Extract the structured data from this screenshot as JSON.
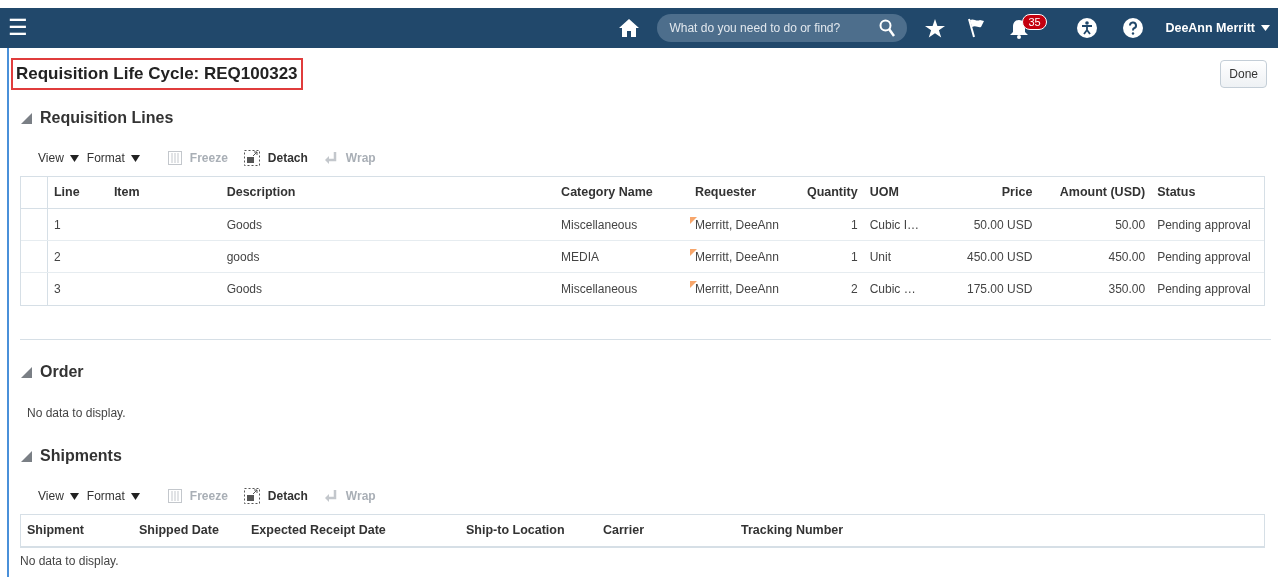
{
  "top_bar": {
    "menu_icon": "☰",
    "search": {
      "placeholder": "What do you need to do or find?"
    },
    "notifications": {
      "count": "35"
    },
    "user": {
      "name": "DeeAnn Merritt"
    }
  },
  "page": {
    "title": "Requisition Life Cycle: REQ100323",
    "done_button": "Done"
  },
  "sections": [
    {
      "kind": "table",
      "title": "Requisition Lines",
      "expanded": true,
      "toolbar": [
        {
          "label": "View",
          "kind": "menu",
          "disabled": false
        },
        {
          "label": "Format",
          "kind": "menu",
          "disabled": false
        },
        {
          "label": "Freeze",
          "kind": "freeze",
          "disabled": true
        },
        {
          "label": "Detach",
          "kind": "detach",
          "disabled": false
        },
        {
          "label": "Wrap",
          "kind": "wrap",
          "disabled": true
        }
      ],
      "columns": [
        "Line",
        "Item",
        "Description",
        "Category Name",
        "Requester",
        "Quantity",
        "UOM",
        "Price",
        "Amount (USD)",
        "Status"
      ],
      "rows": [
        {
          "cells": [
            "1",
            "",
            "Goods",
            "Miscellaneous",
            "Merritt, DeeAnn",
            "1",
            "Cubic I…",
            "50.00 USD",
            "50.00",
            "Pending approval"
          ],
          "flagged": true
        },
        {
          "cells": [
            "2",
            "",
            "goods",
            "MEDIA",
            "Merritt, DeeAnn",
            "1",
            "Unit",
            "450.00 USD",
            "450.00",
            "Pending approval"
          ],
          "flagged": true
        },
        {
          "cells": [
            "3",
            "",
            "Goods",
            "Miscellaneous",
            "Merritt, DeeAnn",
            "2",
            "Cubic …",
            "175.00 USD",
            "350.00",
            "Pending approval"
          ],
          "flagged": true
        }
      ]
    },
    {
      "kind": "text",
      "title": "Order",
      "expanded": true,
      "empty_text": "No data to display."
    },
    {
      "kind": "table",
      "title": "Shipments",
      "expanded": true,
      "toolbar": [
        {
          "label": "View",
          "kind": "menu",
          "disabled": false
        },
        {
          "label": "Format",
          "kind": "menu",
          "disabled": false
        },
        {
          "label": "Freeze",
          "kind": "freeze",
          "disabled": true
        },
        {
          "label": "Detach",
          "kind": "detach",
          "disabled": false
        },
        {
          "label": "Wrap",
          "kind": "wrap",
          "disabled": true
        }
      ],
      "columns": [
        "Shipment",
        "Shipped Date",
        "Expected Receipt Date",
        "Ship-to Location",
        "Carrier",
        "Tracking Number"
      ],
      "empty_text": "No data to display."
    }
  ]
}
